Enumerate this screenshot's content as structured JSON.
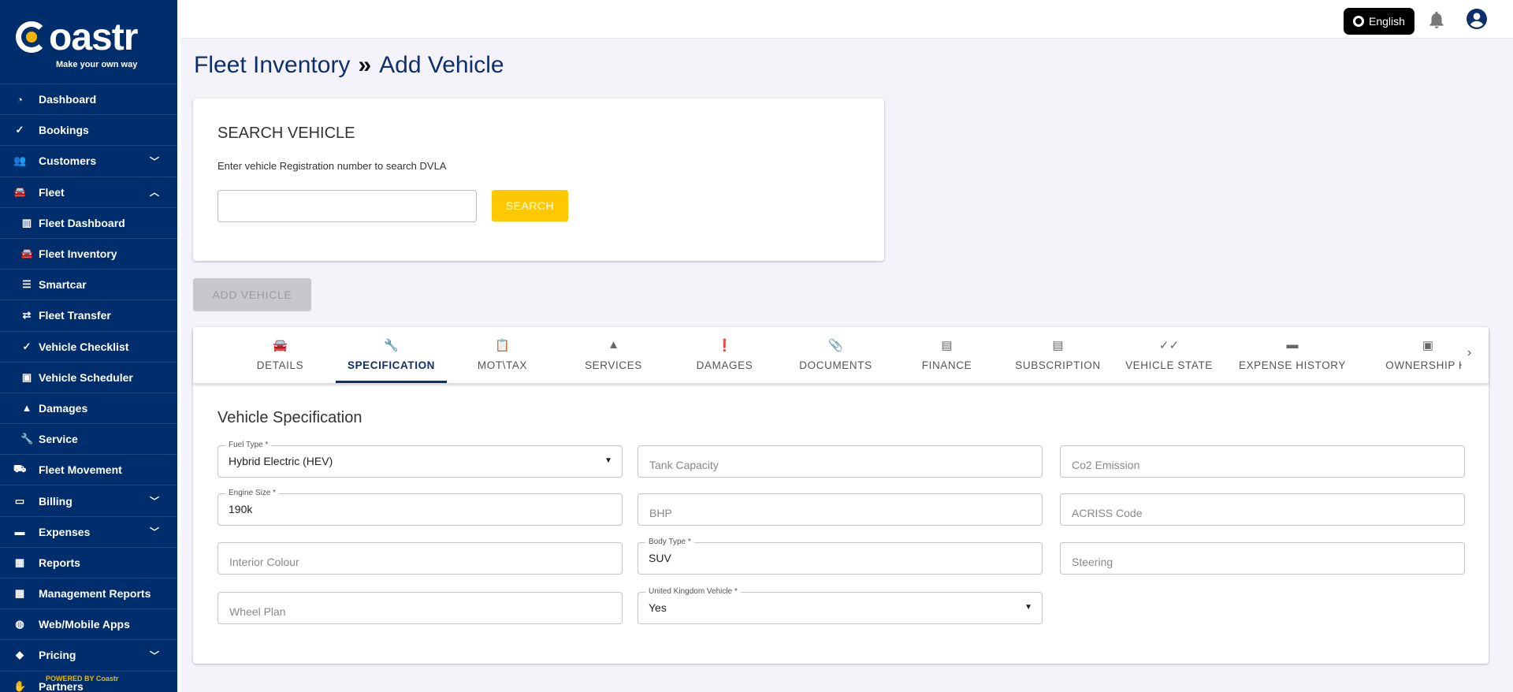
{
  "brand": {
    "name": "Coastr",
    "tagline": "Make your own way",
    "powered_by": "POWERED BY Coastr"
  },
  "sidebar": {
    "items": [
      {
        "label": "Dashboard",
        "icon": "speedometer-icon",
        "glyph": "◔"
      },
      {
        "label": "Bookings",
        "icon": "check-circle-icon",
        "glyph": "✓"
      },
      {
        "label": "Customers",
        "icon": "people-icon",
        "glyph": "👥",
        "chevron": "⌄"
      },
      {
        "label": "Fleet",
        "icon": "car-icon",
        "glyph": "🚘",
        "chevron": "⌃"
      },
      {
        "label": "Fleet Dashboard",
        "icon": "map-icon",
        "glyph": "▥",
        "sub": true
      },
      {
        "label": "Fleet Inventory",
        "icon": "car-icon",
        "glyph": "🚘",
        "sub": true
      },
      {
        "label": "Smartcar",
        "icon": "storage-icon",
        "glyph": "☰",
        "sub": true
      },
      {
        "label": "Fleet Transfer",
        "icon": "transfer-icon",
        "glyph": "⇄",
        "sub": true
      },
      {
        "label": "Vehicle Checklist",
        "icon": "double-check-icon",
        "glyph": "✓",
        "sub": true
      },
      {
        "label": "Vehicle Scheduler",
        "icon": "calendar-icon",
        "glyph": "▣",
        "sub": true
      },
      {
        "label": "Damages",
        "icon": "warning-icon",
        "glyph": "▲",
        "sub": true
      },
      {
        "label": "Service",
        "icon": "wrench-icon",
        "glyph": "🔧",
        "sub": true
      },
      {
        "label": "Fleet Movement",
        "icon": "truck-icon",
        "glyph": "⛟"
      },
      {
        "label": "Billing",
        "icon": "billing-icon",
        "glyph": "▭",
        "chevron": "⌄"
      },
      {
        "label": "Expenses",
        "icon": "credit-card-icon",
        "glyph": "▬",
        "chevron": "⌄"
      },
      {
        "label": "Reports",
        "icon": "bar-chart-icon",
        "glyph": "▦"
      },
      {
        "label": "Management Reports",
        "icon": "bar-chart-icon",
        "glyph": "▦"
      },
      {
        "label": "Web/Mobile Apps",
        "icon": "globe-icon",
        "glyph": "◍"
      },
      {
        "label": "Pricing",
        "icon": "tag-icon",
        "glyph": "◆",
        "chevron": "⌄"
      },
      {
        "label": "Partners",
        "icon": "handshake-icon",
        "glyph": "✋"
      }
    ]
  },
  "topbar": {
    "language": "English"
  },
  "page": {
    "breadcrumb_parent": "Fleet Inventory",
    "separator": "»",
    "title": "Add Vehicle"
  },
  "search": {
    "title": "SEARCH VEHICLE",
    "help": "Enter vehicle Registration number to search DVLA",
    "value": "",
    "button": "SEARCH"
  },
  "add_vehicle": "ADD VEHICLE",
  "tabs": [
    {
      "label": "DETAILS",
      "icon": "car-icon",
      "glyph": "🚘"
    },
    {
      "label": "SPECIFICATION",
      "icon": "wrench-icon",
      "glyph": "🔧",
      "active": true
    },
    {
      "label": "MOT\\TAX",
      "icon": "clipboard-icon",
      "glyph": "📋"
    },
    {
      "label": "SERVICES",
      "icon": "warning-icon",
      "glyph": "▲"
    },
    {
      "label": "DAMAGES",
      "icon": "alert-circle-icon",
      "glyph": "❗"
    },
    {
      "label": "DOCUMENTS",
      "icon": "paperclip-icon",
      "glyph": "📎"
    },
    {
      "label": "FINANCE",
      "icon": "counter-icon",
      "glyph": "▤"
    },
    {
      "label": "SUBSCRIPTION",
      "icon": "counter-icon",
      "glyph": "▤"
    },
    {
      "label": "VEHICLE STATE",
      "icon": "double-check-icon",
      "glyph": "✓✓"
    },
    {
      "label": "EXPENSE HISTORY",
      "icon": "credit-card-icon",
      "glyph": "▬"
    },
    {
      "label": "OWNERSHIP HI",
      "icon": "account-box-icon",
      "glyph": "▣"
    }
  ],
  "spec": {
    "title": "Vehicle Specification",
    "fields": [
      {
        "label": "Fuel Type *",
        "value": "Hybrid Electric (HEV)",
        "select": true
      },
      {
        "placeholder": "Tank Capacity"
      },
      {
        "placeholder": "Co2 Emission"
      },
      {
        "label": "Engine Size *",
        "value": "190k"
      },
      {
        "placeholder": "BHP"
      },
      {
        "placeholder": "ACRISS Code"
      },
      {
        "placeholder": "Interior Colour"
      },
      {
        "label": "Body Type *",
        "value": "SUV"
      },
      {
        "placeholder": "Steering"
      },
      {
        "placeholder": "Wheel Plan"
      },
      {
        "label": "United Kingdom Vehicle *",
        "value": "Yes",
        "select": true
      }
    ]
  },
  "colors": {
    "sidebar": "#002e6c",
    "accent": "#0e2f6b",
    "search_button": "#ffc800"
  }
}
